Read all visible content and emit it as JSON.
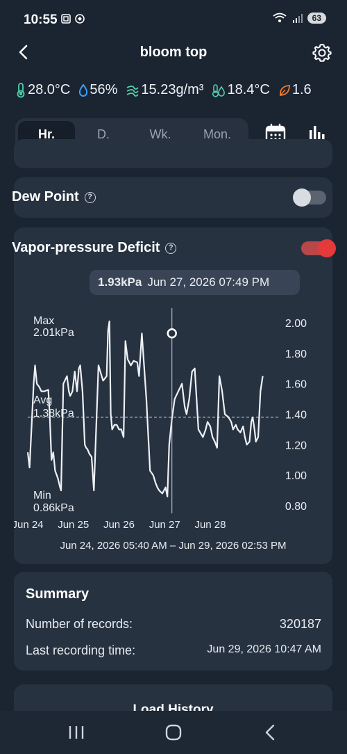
{
  "status": {
    "time": "10:55",
    "battery": "63"
  },
  "header": {
    "title": "bloom top"
  },
  "metrics": [
    {
      "icon": "thermometer-icon",
      "value": "28.0°C",
      "color": "#4fd0a8"
    },
    {
      "icon": "droplet-icon",
      "value": "56%",
      "color": "#3aa0ff"
    },
    {
      "icon": "wind-icon",
      "value": "15.23g/m³",
      "color": "#4fd0a8"
    },
    {
      "icon": "dew-thermometer-icon",
      "value": "18.4°C",
      "color": "#4fd0a8"
    },
    {
      "icon": "leaf-icon",
      "value": "1.6",
      "color": "#f07b2c"
    }
  ],
  "tabs": [
    "Hr.",
    "D.",
    "Wk.",
    "Mon."
  ],
  "dew_point": {
    "label": "Dew Point",
    "enabled": false
  },
  "vpd": {
    "label": "Vapor-pressure Deficit",
    "enabled": true,
    "tooltip_value": "1.93kPa",
    "tooltip_time": "Jun 27, 2026 07:49 PM",
    "max_label": "Max",
    "max_value": "2.01kPa",
    "avg_label": "Avg",
    "avg_value": "1.38kPa",
    "min_label": "Min",
    "min_value": "0.86kPa",
    "range": "Jun 24, 2026 05:40 AM – Jun 29, 2026 02:53 PM"
  },
  "chart_data": {
    "type": "line",
    "x_labels": [
      "Jun 24",
      "Jun 25",
      "Jun 26",
      "Jun 27",
      "Jun 28"
    ],
    "y_ticks": [
      "2.00",
      "1.80",
      "1.60",
      "1.40",
      "1.20",
      "1.00",
      "0.80"
    ],
    "ylim": [
      0.75,
      2.05
    ],
    "avg": 1.38,
    "x_span_days": [
      0,
      5.4
    ],
    "series": [
      {
        "x": [
          0,
          0.04,
          0.08,
          0.13,
          0.16,
          0.2,
          0.25,
          0.3,
          0.36,
          0.45,
          0.48,
          0.52,
          0.56,
          0.6,
          0.66,
          0.7,
          0.73,
          0.78,
          0.86,
          0.9,
          0.93,
          0.98,
          1.03,
          1.08,
          1.12,
          1.15,
          1.2,
          1.25,
          1.28,
          1.31,
          1.35,
          1.4,
          1.45,
          1.55,
          1.65,
          1.73,
          1.76,
          1.79,
          1.82,
          1.85,
          1.9,
          1.95,
          2.0,
          2.05,
          2.1,
          2.14,
          2.19,
          2.26,
          2.32,
          2.4,
          2.44,
          2.5,
          2.6,
          2.68,
          2.75,
          2.8,
          2.84,
          2.88,
          2.95,
          3.02,
          3.06,
          3.1,
          3.16,
          3.22,
          3.3,
          3.38,
          3.44,
          3.48,
          3.54,
          3.6,
          3.66,
          3.74,
          3.84,
          3.9,
          3.94,
          4.0,
          4.05,
          4.1,
          4.15,
          4.2,
          4.26,
          4.32,
          4.4,
          4.46,
          4.5,
          4.56,
          4.6,
          4.66,
          4.72,
          4.76,
          4.8,
          4.86,
          4.9,
          4.93,
          4.97,
          5.0,
          5.05,
          5.1,
          5.15
        ],
        "y": [
          1.15,
          1.05,
          1.3,
          1.6,
          1.72,
          1.6,
          1.58,
          1.55,
          1.55,
          1.56,
          1.4,
          1.1,
          1.15,
          1.03,
          0.98,
          0.93,
          0.9,
          1.6,
          1.65,
          1.55,
          1.52,
          1.55,
          1.68,
          1.55,
          1.7,
          1.72,
          1.55,
          1.2,
          1.18,
          1.17,
          1.14,
          1.12,
          0.9,
          1.72,
          1.62,
          1.65,
          1.95,
          2.01,
          1.4,
          1.3,
          1.33,
          1.33,
          1.3,
          1.3,
          1.25,
          1.88,
          1.76,
          1.72,
          1.75,
          1.74,
          1.65,
          1.93,
          1.5,
          1.03,
          1.0,
          0.95,
          0.92,
          0.9,
          0.88,
          0.92,
          0.86,
          1.2,
          1.37,
          1.5,
          1.55,
          1.6,
          1.45,
          1.4,
          1.5,
          1.68,
          1.7,
          1.3,
          1.25,
          1.3,
          1.35,
          1.32,
          1.25,
          1.22,
          1.18,
          1.65,
          1.55,
          1.4,
          1.38,
          1.35,
          1.3,
          1.33,
          1.3,
          1.28,
          1.32,
          1.25,
          1.2,
          1.22,
          1.35,
          1.38,
          1.3,
          1.22,
          1.25,
          1.55,
          1.65
        ]
      }
    ],
    "cursor_x": 3.16,
    "cursor_y": 1.93
  },
  "summary": {
    "title": "Summary",
    "records_label": "Number of records:",
    "records_value": "320187",
    "last_label": "Last recording time:",
    "last_value": "Jun 29, 2026 10:47 AM"
  },
  "history": {
    "title": "Load History"
  }
}
